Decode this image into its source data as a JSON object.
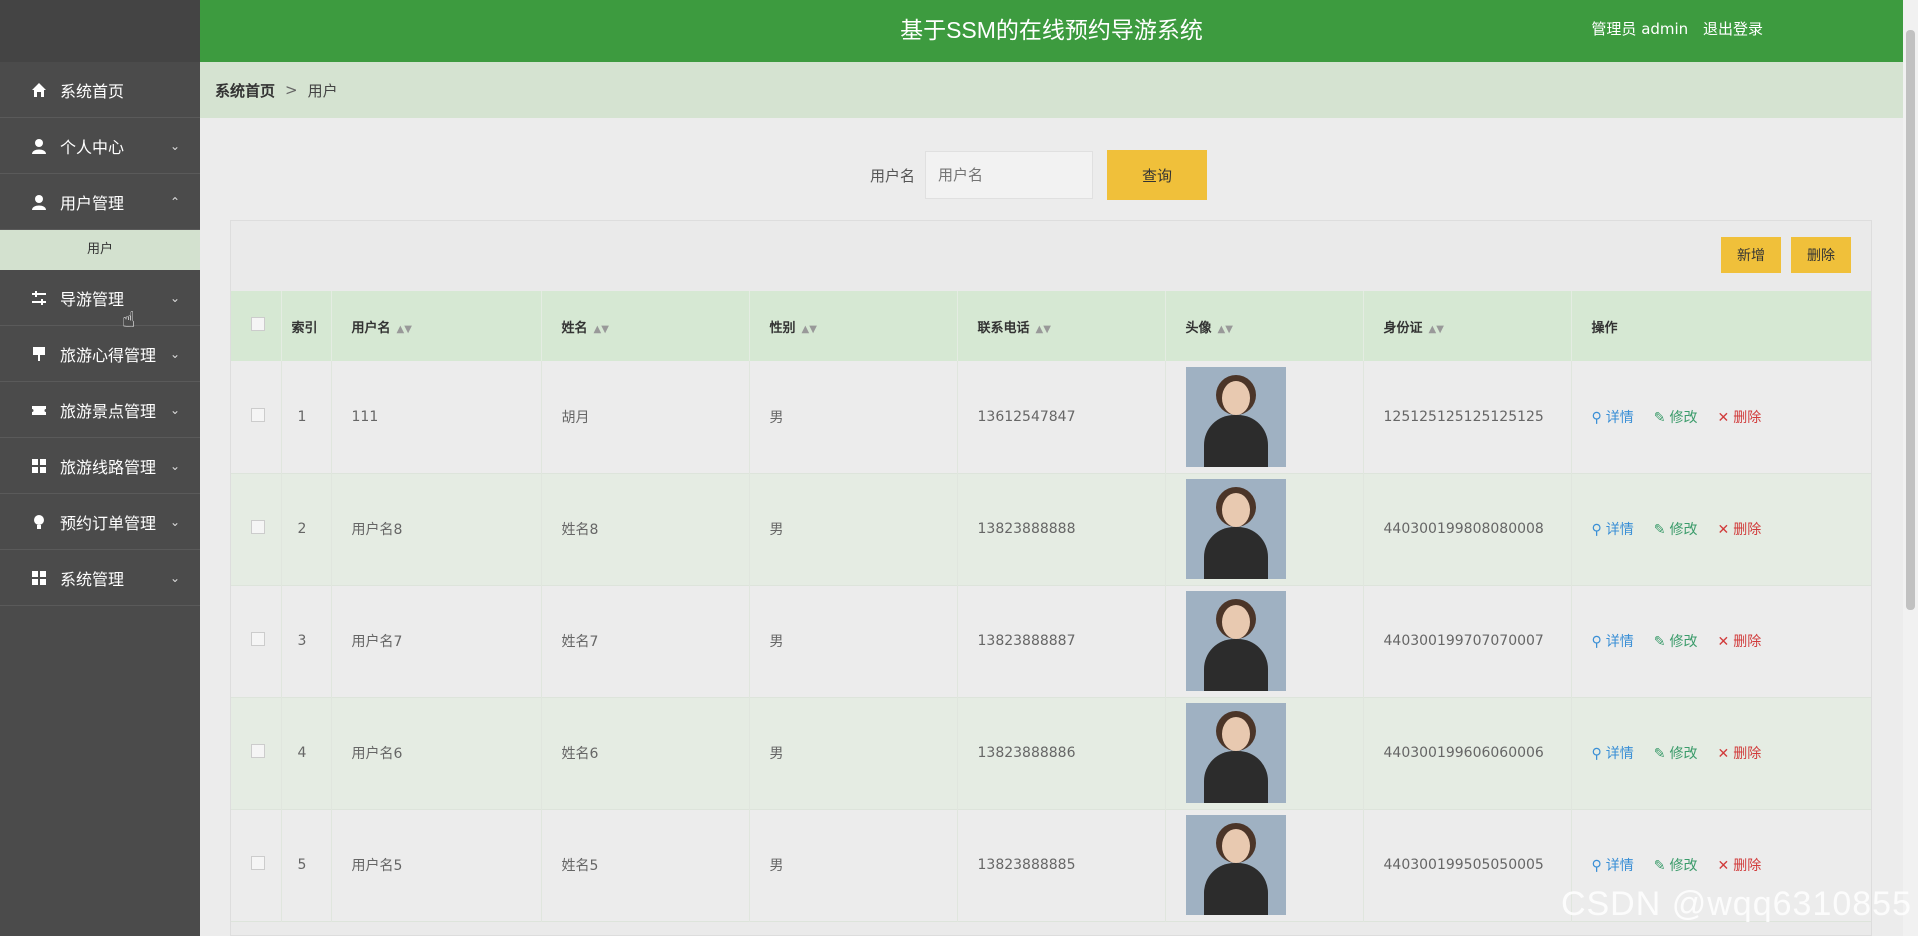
{
  "header": {
    "title": "基于SSM的在线预约导游系统",
    "user_label": "管理员 admin",
    "logout": "退出登录",
    "bg_color": "#3d9b3f"
  },
  "sidebar": {
    "items": [
      {
        "label": "系统首页",
        "icon": "home-icon",
        "expanded": false
      },
      {
        "label": "个人中心",
        "icon": "user-icon",
        "expanded": false
      },
      {
        "label": "用户管理",
        "icon": "user-manage-icon",
        "expanded": true,
        "children": [
          "用户"
        ]
      },
      {
        "label": "导游管理",
        "icon": "sliders-icon",
        "expanded": false
      },
      {
        "label": "旅游心得管理",
        "icon": "flag-icon",
        "expanded": false
      },
      {
        "label": "旅游景点管理",
        "icon": "ticket-icon",
        "expanded": false
      },
      {
        "label": "旅游线路管理",
        "icon": "grid-icon",
        "expanded": false
      },
      {
        "label": "预约订单管理",
        "icon": "bulb-icon",
        "expanded": false
      },
      {
        "label": "系统管理",
        "icon": "grid-icon",
        "expanded": false
      }
    ]
  },
  "breadcrumb": {
    "home": "系统首页",
    "separator": ">",
    "current": "用户"
  },
  "search": {
    "label": "用户名",
    "placeholder": "用户名",
    "button": "查询"
  },
  "toolbar": {
    "add": "新增",
    "delete": "删除"
  },
  "table": {
    "headers": [
      "",
      "索引",
      "用户名",
      "姓名",
      "性别",
      "联系电话",
      "头像",
      "身份证",
      "操作"
    ],
    "ops": {
      "detail": "详情",
      "edit": "修改",
      "delete": "删除"
    },
    "rows": [
      {
        "index": "1",
        "username": "111",
        "name": "胡月",
        "gender": "男",
        "phone": "13612547847",
        "id_card": "125125125125125125"
      },
      {
        "index": "2",
        "username": "用户名8",
        "name": "姓名8",
        "gender": "男",
        "phone": "13823888888",
        "id_card": "440300199808080008"
      },
      {
        "index": "3",
        "username": "用户名7",
        "name": "姓名7",
        "gender": "男",
        "phone": "13823888887",
        "id_card": "440300199707070007"
      },
      {
        "index": "4",
        "username": "用户名6",
        "name": "姓名6",
        "gender": "男",
        "phone": "13823888886",
        "id_card": "440300199606060006"
      },
      {
        "index": "5",
        "username": "用户名5",
        "name": "姓名5",
        "gender": "男",
        "phone": "13823888885",
        "id_card": "440300199505050005"
      }
    ]
  },
  "watermark": "CSDN @wqq6310855"
}
